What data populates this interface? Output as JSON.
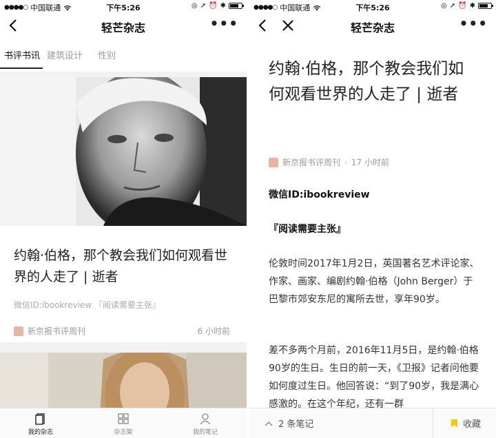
{
  "status": {
    "carrier": "中国联通",
    "time": "下午5:26"
  },
  "left": {
    "nav_title": "轻芒杂志",
    "tabs": [
      "书评书讯",
      "建筑设计",
      "性别"
    ],
    "card": {
      "title": "约翰·伯格，那个教会我们如何观看世界的人走了 | 逝者",
      "tag": "微信ID:ibookreview 『阅读需要主张』",
      "source": "新京报书评周刊",
      "time": "6 小时前"
    },
    "tabbar": [
      "我的杂志",
      "杂志架",
      "我的笔记"
    ]
  },
  "right": {
    "nav_title": "轻芒杂志",
    "article": {
      "title": "约翰·伯格，那个教会我们如何观看世界的人走了 | 逝者",
      "source": "新京报书评周刊",
      "time": "17 小时前",
      "wechat_id": "微信ID:ibookreview",
      "slogan": "『阅读需要主张』",
      "para1": "伦敦时间2017年1月2日，英国著名艺术评论家、作家、画家、编剧约翰·伯格（John Berger）于巴黎市郊安东尼的寓所去世，享年90岁。",
      "para2": "差不多两个月前，2016年11月5日，是约翰·伯格90岁的生日。生日的前一天，《卫报》记者问他要如何度过生日。他回答说：“到了90岁，我是满心感激的。在这个年纪，还有一群"
    },
    "footer": {
      "notes": "2 条笔记",
      "favorite": "收藏"
    }
  }
}
